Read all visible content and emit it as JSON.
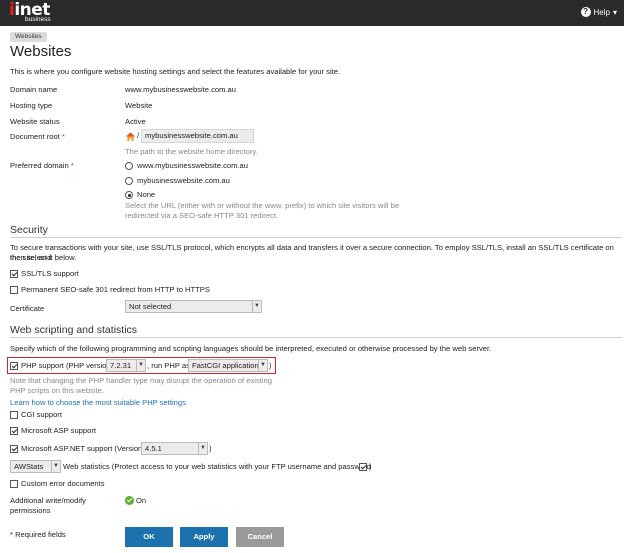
{
  "header": {
    "logo_main_first": "i",
    "logo_main_rest": "inet",
    "logo_sub": "business",
    "help_label": "Help",
    "help_caret": "▾",
    "help_icon": "question-circle-icon"
  },
  "breadcrumb": {
    "item": "Websites"
  },
  "page": {
    "title": "Websites",
    "intro": "This is where you configure website hosting settings and select the features available for your site."
  },
  "general": {
    "domain_name_label": "Domain name",
    "domain_name_value": "www.mybusinesswebsite.com.au",
    "hosting_type_label": "Hosting type",
    "hosting_type_value": "Website",
    "status_label": "Website status",
    "status_value": "Active",
    "docroot_label": "Document root",
    "required_mark": "*",
    "docroot_slash": "/",
    "docroot_value": "mybusinesswebsite.com.au",
    "docroot_hint": "The path to the website home directory.",
    "preferred_label": "Preferred domain",
    "preferred_options": [
      "www.mybusinesswebsite.com.au",
      "mybusinesswebsite.com.au",
      "None"
    ],
    "preferred_selected": "None",
    "preferred_hint_1": "Select the URL (either with or without the www. prefix) to which site visitors will be",
    "preferred_hint_2": "redirected via a SEO-safe HTTP 301 redirect."
  },
  "security": {
    "title": "Security",
    "desc_1": "To secure transactions with your site, use SSL/TLS protocol, which encrypts all data and transfers it over a secure connection. To employ SSL/TLS, install an SSL/TLS certificate on the site, and",
    "desc_2": "then select it below.",
    "ssl_label": "SSL/TLS support",
    "ssl_checked": true,
    "redirect_label": "Permanent SEO-safe 301 redirect from HTTP to HTTPS",
    "redirect_checked": false,
    "cert_label": "Certificate",
    "cert_value": "Not selected"
  },
  "scripting": {
    "title": "Web scripting and statistics",
    "desc": "Specify which of the following programming and scripting languages should be interpreted, executed or otherwise processed by the web server.",
    "php_label": "PHP support (PHP version",
    "php_version": "7.2.31",
    "php_run_as": ", run PHP as",
    "php_handler": "FastCGI application",
    "php_close": ")",
    "php_checked": true,
    "php_note_1": "Note that changing the PHP handler type may disrupt the operation of existing",
    "php_note_2": "PHP scripts on this website.",
    "php_link": "Learn how to choose the most suitable PHP settings",
    "cgi_label": "CGI support",
    "cgi_checked": false,
    "asp_label": "Microsoft ASP support",
    "asp_checked": true,
    "aspnet_label": "Microsoft ASP.NET support (Version",
    "aspnet_version": "4.5.1",
    "aspnet_close": ")",
    "aspnet_checked": true,
    "stats_value": "AWStats",
    "stats_label": "Web statistics (Protect access to your web statistics with your FTP username and password",
    "stats_close": ")",
    "stats_checked": true,
    "errdocs_label": "Custom error documents",
    "errdocs_checked": false,
    "perm_label_1": "Additional write/modify",
    "perm_label_2": "permissions",
    "perm_value": "On"
  },
  "footer": {
    "required_note": "* Required fields",
    "ok": "OK",
    "apply": "Apply",
    "cancel": "Cancel"
  },
  "colors": {
    "accent": "#1b72ad",
    "highlight": "#d0262c",
    "on": "#5cb030",
    "header_bg": "#2b2b2b"
  }
}
